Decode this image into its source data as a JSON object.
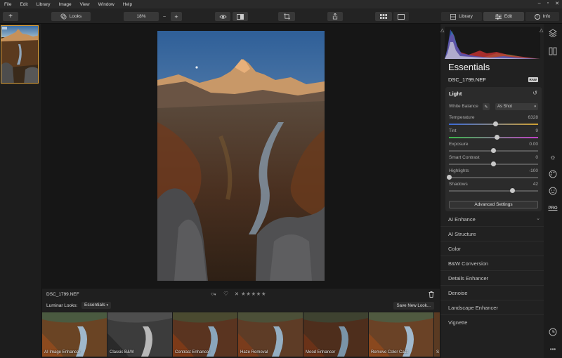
{
  "menu": [
    "File",
    "Edit",
    "Library",
    "Image",
    "View",
    "Window",
    "Help"
  ],
  "toolbar": {
    "add": "+",
    "looks": "Looks",
    "zoom": "18%",
    "zoom_minus": "–",
    "zoom_plus": "+",
    "library": "Library",
    "edit": "Edit",
    "info": "Info"
  },
  "panel": {
    "title": "Essentials",
    "filename": "DSC_1799.NEF",
    "raw_badge": "RAW"
  },
  "light": {
    "title": "Light",
    "white_balance_label": "White Balance",
    "white_balance_value": "As Shot",
    "sliders": [
      {
        "label": "Temperature",
        "value": "6328",
        "pos": 0.52
      },
      {
        "label": "Tint",
        "value": "9",
        "pos": 0.54
      },
      {
        "label": "Exposure",
        "value": "0.00",
        "pos": 0.5
      },
      {
        "label": "Smart Contrast",
        "value": "0",
        "pos": 0.5
      },
      {
        "label": "Highlights",
        "value": "-100",
        "pos": 0.0
      },
      {
        "label": "Shadows",
        "value": "42",
        "pos": 0.71
      }
    ],
    "advanced": "Advanced Settings"
  },
  "tools": [
    "AI Enhance",
    "AI Structure",
    "Color",
    "B&W Conversion",
    "Details Enhancer",
    "Denoise",
    "Landscape Enhancer",
    "Vignette"
  ],
  "infobar": {
    "filename": "DSC_1799.NEF",
    "reject": "✕"
  },
  "looks": {
    "label": "Luminar Looks:",
    "category": "Essentials",
    "save": "Save New Look...",
    "items": [
      "AI Image Enhancer",
      "Classic B&W",
      "Contrast Enhancer",
      "Haze Removal",
      "Mood Enhancer",
      "Remove Color Cast",
      "S"
    ]
  },
  "colors": {
    "accent": "#e0a33a"
  }
}
